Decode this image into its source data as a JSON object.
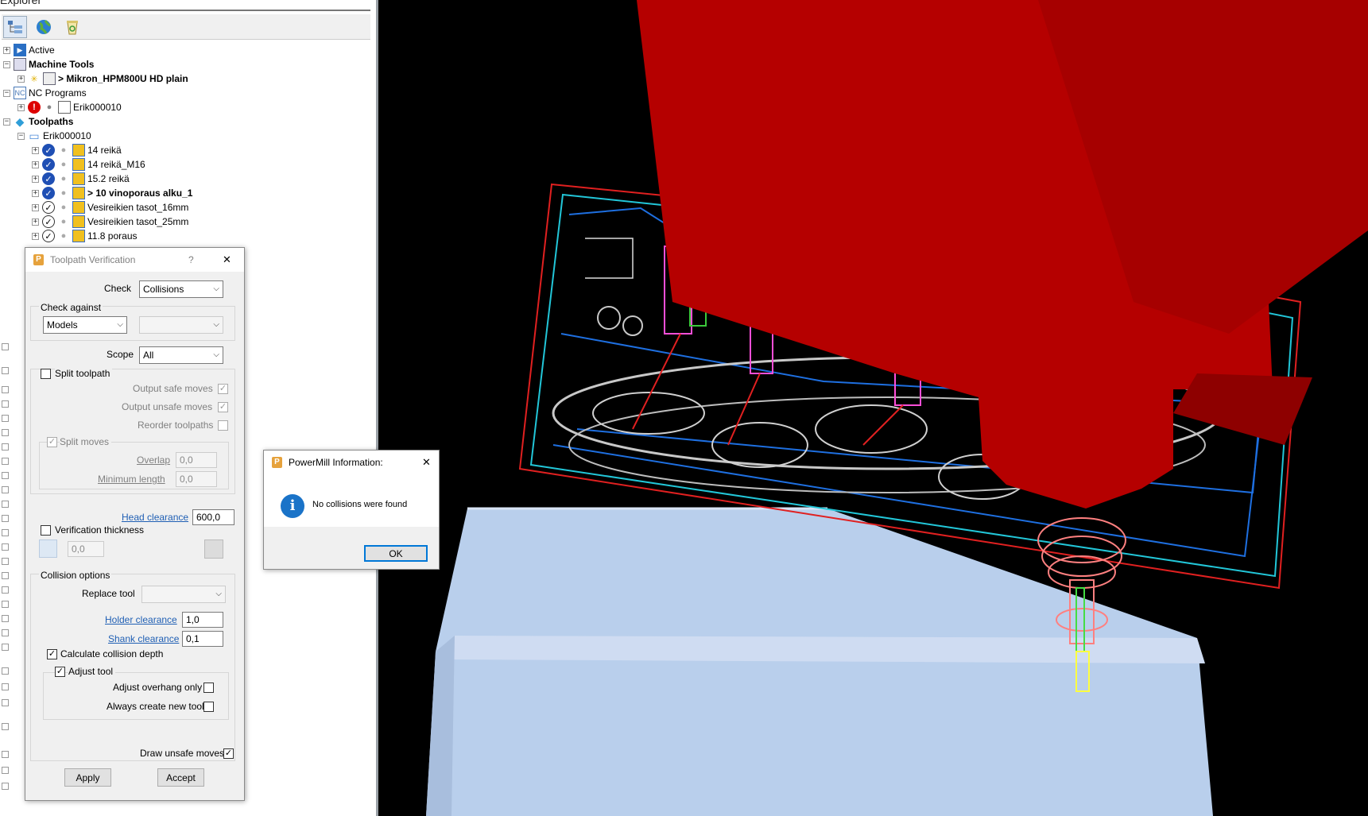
{
  "explorer": {
    "title": "Explorer",
    "tree": [
      {
        "label": "Active",
        "bold": false
      },
      {
        "label": "Machine Tools",
        "bold": true
      },
      {
        "label": "> Mikron_HPM800U HD plain",
        "bold": true
      },
      {
        "label": "NC Programs",
        "bold": false
      },
      {
        "label": "Erik000010",
        "bold": false
      },
      {
        "label": "Toolpaths",
        "bold": true
      },
      {
        "label": "Erik000010",
        "bold": false
      },
      {
        "label": "14 reikä",
        "bold": false
      },
      {
        "label": "14 reikä_M16",
        "bold": false
      },
      {
        "label": "15.2 reikä",
        "bold": false
      },
      {
        "label": "> 10 vinoporaus alku_1",
        "bold": true
      },
      {
        "label": "Vesireikien tasot_16mm",
        "bold": false
      },
      {
        "label": "Vesireikien tasot_25mm",
        "bold": false
      },
      {
        "label": "11.8 poraus",
        "bold": false
      }
    ]
  },
  "verification": {
    "title": "Toolpath Verification",
    "help": "?",
    "close": "✕",
    "check_label": "Check",
    "check_value": "Collisions",
    "check_against_label": "Check against",
    "check_against_value": "Models",
    "check_against_second": "",
    "scope_label": "Scope",
    "scope_value": "All",
    "split_toolpath": "Split toolpath",
    "output_safe": "Output safe moves",
    "output_unsafe": "Output unsafe moves",
    "reorder": "Reorder toolpaths",
    "split_moves": "Split moves",
    "overlap_label": "Overlap",
    "overlap_value": "0,0",
    "min_length_label": "Minimum length",
    "min_length_value": "0,0",
    "head_clearance_label": "Head clearance",
    "head_clearance_value": "600,0",
    "verification_thickness": "Verification thickness",
    "thickness_value": "0,0",
    "collision_options": "Collision options",
    "replace_tool_label": "Replace tool",
    "replace_tool_value": "",
    "holder_clearance_label": "Holder clearance",
    "holder_clearance_value": "1,0",
    "shank_clearance_label": "Shank clearance",
    "shank_clearance_value": "0,1",
    "calc_depth": "Calculate collision depth",
    "adjust_tool": "Adjust tool",
    "adjust_overhang": "Adjust overhang only",
    "always_create": "Always create new tool",
    "draw_unsafe": "Draw unsafe moves",
    "apply": "Apply",
    "accept": "Accept",
    "checkmark": "✓"
  },
  "info": {
    "title": "PowerMill Information:",
    "close": "✕",
    "icon": "i",
    "message": "No collisions were found",
    "ok": "OK"
  },
  "colors": {
    "head_red": "#b50000",
    "table_blue": "#b9cfec",
    "wire_blue": "#1e6fe0",
    "wire_cyan": "#22c6d8",
    "wire_red": "#e02020"
  }
}
